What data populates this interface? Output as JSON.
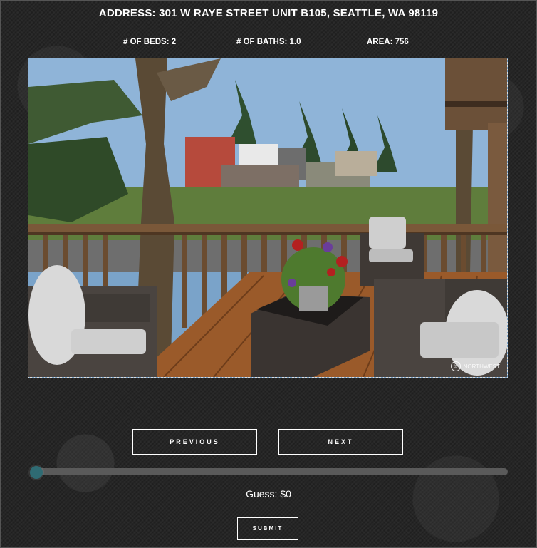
{
  "header": {
    "address": "ADDRESS: 301 W RAYE STREET UNIT B105, SEATTLE, WA 98119",
    "beds": "# OF BEDS: 2",
    "baths": "# OF BATHS: 1.0",
    "area": "AREA: 756"
  },
  "photo": {
    "watermark_text": "NORTHWEST",
    "watermark_icon": "nwmls-logo-icon"
  },
  "controls": {
    "previous_label": "PREVIOUS",
    "next_label": "NEXT",
    "slider_value": 0,
    "guess_text": "Guess: $0",
    "submit_label": "SUBMIT"
  },
  "colors": {
    "background": "#262626",
    "slider_track": "#5a5a5a",
    "slider_thumb": "#2f6b73",
    "button_border": "#ffffff"
  }
}
